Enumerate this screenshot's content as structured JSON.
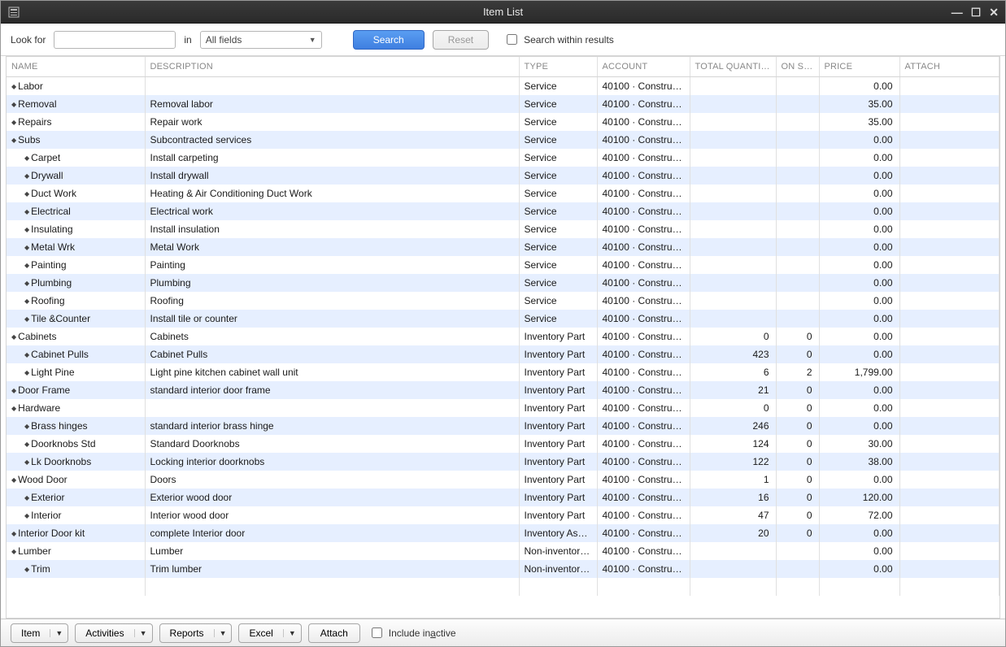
{
  "window": {
    "title": "Item List"
  },
  "search": {
    "look_for_label": "Look for",
    "in_label": "in",
    "field_value": "All fields",
    "search_btn": "Search",
    "reset_btn": "Reset",
    "within_label": "Search within results"
  },
  "columns": {
    "name": "NAME",
    "description": "DESCRIPTION",
    "type": "TYPE",
    "account": "ACCOUNT",
    "total_qty": "TOTAL QUANTITY ...",
    "on_sales": "ON SA...",
    "price": "PRICE",
    "attach": "ATTACH"
  },
  "rows": [
    {
      "indent": 0,
      "name": "Labor",
      "description": "",
      "type": "Service",
      "account": "40100 · Constructi...",
      "qty": "",
      "sales": "",
      "price": "0.00"
    },
    {
      "indent": 0,
      "name": "Removal",
      "description": "Removal labor",
      "type": "Service",
      "account": "40100 · Constructi...",
      "qty": "",
      "sales": "",
      "price": "35.00"
    },
    {
      "indent": 0,
      "name": "Repairs",
      "description": "Repair work",
      "type": "Service",
      "account": "40100 · Constructi...",
      "qty": "",
      "sales": "",
      "price": "35.00"
    },
    {
      "indent": 0,
      "name": "Subs",
      "description": "Subcontracted services",
      "type": "Service",
      "account": "40100 · Constructi...",
      "qty": "",
      "sales": "",
      "price": "0.00"
    },
    {
      "indent": 1,
      "name": "Carpet",
      "description": "Install carpeting",
      "type": "Service",
      "account": "40100 · Constructi...",
      "qty": "",
      "sales": "",
      "price": "0.00"
    },
    {
      "indent": 1,
      "name": "Drywall",
      "description": "Install drywall",
      "type": "Service",
      "account": "40100 · Constructi...",
      "qty": "",
      "sales": "",
      "price": "0.00"
    },
    {
      "indent": 1,
      "name": "Duct Work",
      "description": "Heating & Air Conditioning Duct Work",
      "type": "Service",
      "account": "40100 · Constructi...",
      "qty": "",
      "sales": "",
      "price": "0.00"
    },
    {
      "indent": 1,
      "name": "Electrical",
      "description": "Electrical work",
      "type": "Service",
      "account": "40100 · Constructi...",
      "qty": "",
      "sales": "",
      "price": "0.00"
    },
    {
      "indent": 1,
      "name": "Insulating",
      "description": "Install insulation",
      "type": "Service",
      "account": "40100 · Constructi...",
      "qty": "",
      "sales": "",
      "price": "0.00"
    },
    {
      "indent": 1,
      "name": "Metal Wrk",
      "description": "Metal Work",
      "type": "Service",
      "account": "40100 · Constructi...",
      "qty": "",
      "sales": "",
      "price": "0.00"
    },
    {
      "indent": 1,
      "name": "Painting",
      "description": "Painting",
      "type": "Service",
      "account": "40100 · Constructi...",
      "qty": "",
      "sales": "",
      "price": "0.00"
    },
    {
      "indent": 1,
      "name": "Plumbing",
      "description": "Plumbing",
      "type": "Service",
      "account": "40100 · Constructi...",
      "qty": "",
      "sales": "",
      "price": "0.00"
    },
    {
      "indent": 1,
      "name": "Roofing",
      "description": "Roofing",
      "type": "Service",
      "account": "40100 · Constructi...",
      "qty": "",
      "sales": "",
      "price": "0.00"
    },
    {
      "indent": 1,
      "name": "Tile &Counter",
      "description": "Install tile or counter",
      "type": "Service",
      "account": "40100 · Constructi...",
      "qty": "",
      "sales": "",
      "price": "0.00"
    },
    {
      "indent": 0,
      "name": "Cabinets",
      "description": "Cabinets",
      "type": "Inventory Part",
      "account": "40100 · Constructi...",
      "qty": "0",
      "sales": "0",
      "price": "0.00"
    },
    {
      "indent": 1,
      "name": "Cabinet Pulls",
      "description": "Cabinet Pulls",
      "type": "Inventory Part",
      "account": "40100 · Constructi...",
      "qty": "423",
      "sales": "0",
      "price": "0.00"
    },
    {
      "indent": 1,
      "name": "Light Pine",
      "description": "Light pine kitchen cabinet wall unit",
      "type": "Inventory Part",
      "account": "40100 · Constructi...",
      "qty": "6",
      "sales": "2",
      "price": "1,799.00"
    },
    {
      "indent": 0,
      "name": "Door Frame",
      "description": "standard interior door frame",
      "type": "Inventory Part",
      "account": "40100 · Constructi...",
      "qty": "21",
      "sales": "0",
      "price": "0.00"
    },
    {
      "indent": 0,
      "name": "Hardware",
      "description": "",
      "type": "Inventory Part",
      "account": "40100 · Constructi...",
      "qty": "0",
      "sales": "0",
      "price": "0.00"
    },
    {
      "indent": 1,
      "name": "Brass hinges",
      "description": "standard interior brass hinge",
      "type": "Inventory Part",
      "account": "40100 · Constructi...",
      "qty": "246",
      "sales": "0",
      "price": "0.00"
    },
    {
      "indent": 1,
      "name": "Doorknobs Std",
      "description": "Standard Doorknobs",
      "type": "Inventory Part",
      "account": "40100 · Constructi...",
      "qty": "124",
      "sales": "0",
      "price": "30.00"
    },
    {
      "indent": 1,
      "name": "Lk Doorknobs",
      "description": "Locking interior doorknobs",
      "type": "Inventory Part",
      "account": "40100 · Constructi...",
      "qty": "122",
      "sales": "0",
      "price": "38.00"
    },
    {
      "indent": 0,
      "name": "Wood Door",
      "description": "Doors",
      "type": "Inventory Part",
      "account": "40100 · Constructi...",
      "qty": "1",
      "sales": "0",
      "price": "0.00"
    },
    {
      "indent": 1,
      "name": "Exterior",
      "description": "Exterior wood door",
      "type": "Inventory Part",
      "account": "40100 · Constructi...",
      "qty": "16",
      "sales": "0",
      "price": "120.00"
    },
    {
      "indent": 1,
      "name": "Interior",
      "description": "Interior wood door",
      "type": "Inventory Part",
      "account": "40100 · Constructi...",
      "qty": "47",
      "sales": "0",
      "price": "72.00"
    },
    {
      "indent": 0,
      "name": "Interior Door kit",
      "description": "complete Interior door",
      "type": "Inventory Asse...",
      "account": "40100 · Constructi...",
      "qty": "20",
      "sales": "0",
      "price": "0.00"
    },
    {
      "indent": 0,
      "name": "Lumber",
      "description": "Lumber",
      "type": "Non-inventory ...",
      "account": "40100 · Constructi...",
      "qty": "",
      "sales": "",
      "price": "0.00"
    },
    {
      "indent": 1,
      "name": "Trim",
      "description": "Trim lumber",
      "type": "Non-inventory ...",
      "account": "40100 · Constructi...",
      "qty": "",
      "sales": "",
      "price": "0.00"
    },
    {
      "indent": -1,
      "name": "",
      "description": "",
      "type": "",
      "account": "",
      "qty": "",
      "sales": "",
      "price": ""
    }
  ],
  "footer": {
    "item": "Item",
    "activities": "Activities",
    "reports": "Reports",
    "excel": "Excel",
    "attach": "Attach",
    "include_inactive": "Include inactive"
  }
}
